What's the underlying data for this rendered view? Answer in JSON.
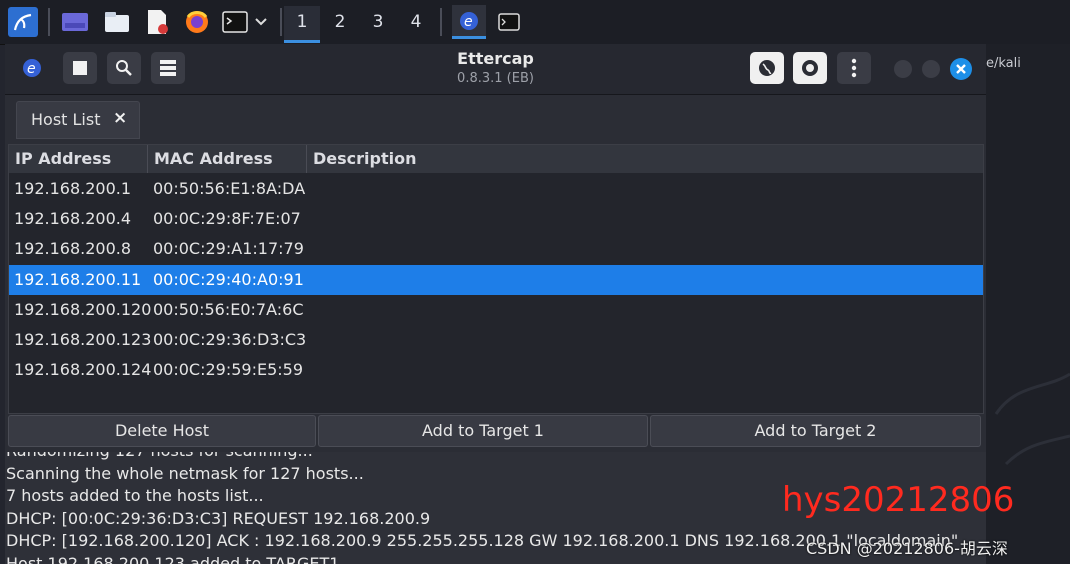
{
  "taskbar": {
    "workspaces": [
      "1",
      "2",
      "3",
      "4"
    ],
    "active_workspace": "1"
  },
  "window": {
    "title": "Ettercap",
    "subtitle": "0.8.3.1 (EB)"
  },
  "tab": {
    "label": "Host List",
    "close": "×"
  },
  "hosts": {
    "columns": [
      "IP Address",
      "MAC Address",
      "Description"
    ],
    "rows": [
      {
        "ip": "192.168.200.1",
        "mac": "00:50:56:E1:8A:DA",
        "desc": ""
      },
      {
        "ip": "192.168.200.4",
        "mac": "00:0C:29:8F:7E:07",
        "desc": ""
      },
      {
        "ip": "192.168.200.8",
        "mac": "00:0C:29:A1:17:79",
        "desc": ""
      },
      {
        "ip": "192.168.200.11",
        "mac": "00:0C:29:40:A0:91",
        "desc": ""
      },
      {
        "ip": "192.168.200.120",
        "mac": "00:50:56:E0:7A:6C",
        "desc": ""
      },
      {
        "ip": "192.168.200.123",
        "mac": "00:0C:29:36:D3:C3",
        "desc": ""
      },
      {
        "ip": "192.168.200.124",
        "mac": "00:0C:29:59:E5:59",
        "desc": ""
      }
    ],
    "selected_index": 3
  },
  "buttons": {
    "delete_host": "Delete Host",
    "add_target1": "Add to Target 1",
    "add_target2": "Add to Target 2"
  },
  "log": [
    "Randomizing 127 hosts for scanning...",
    "Scanning the whole netmask for 127 hosts...",
    "7 hosts added to the hosts list...",
    "DHCP: [00:0C:29:36:D3:C3] REQUEST 192.168.200.9",
    "DHCP: [192.168.200.120] ACK : 192.168.200.9 255.255.255.128 GW 192.168.200.1 DNS 192.168.200.1 \"localdomain\"",
    "Host 192.168.200.123 added to TARGET1"
  ],
  "desktop": {
    "path_fragment": "e/kali"
  },
  "watermarks": {
    "red_text": "hys20212806",
    "csdn": "CSDN @20212806-胡云深"
  },
  "colors": {
    "accent": "#1e7ee8",
    "watermark_red": "#ff2a1f"
  }
}
